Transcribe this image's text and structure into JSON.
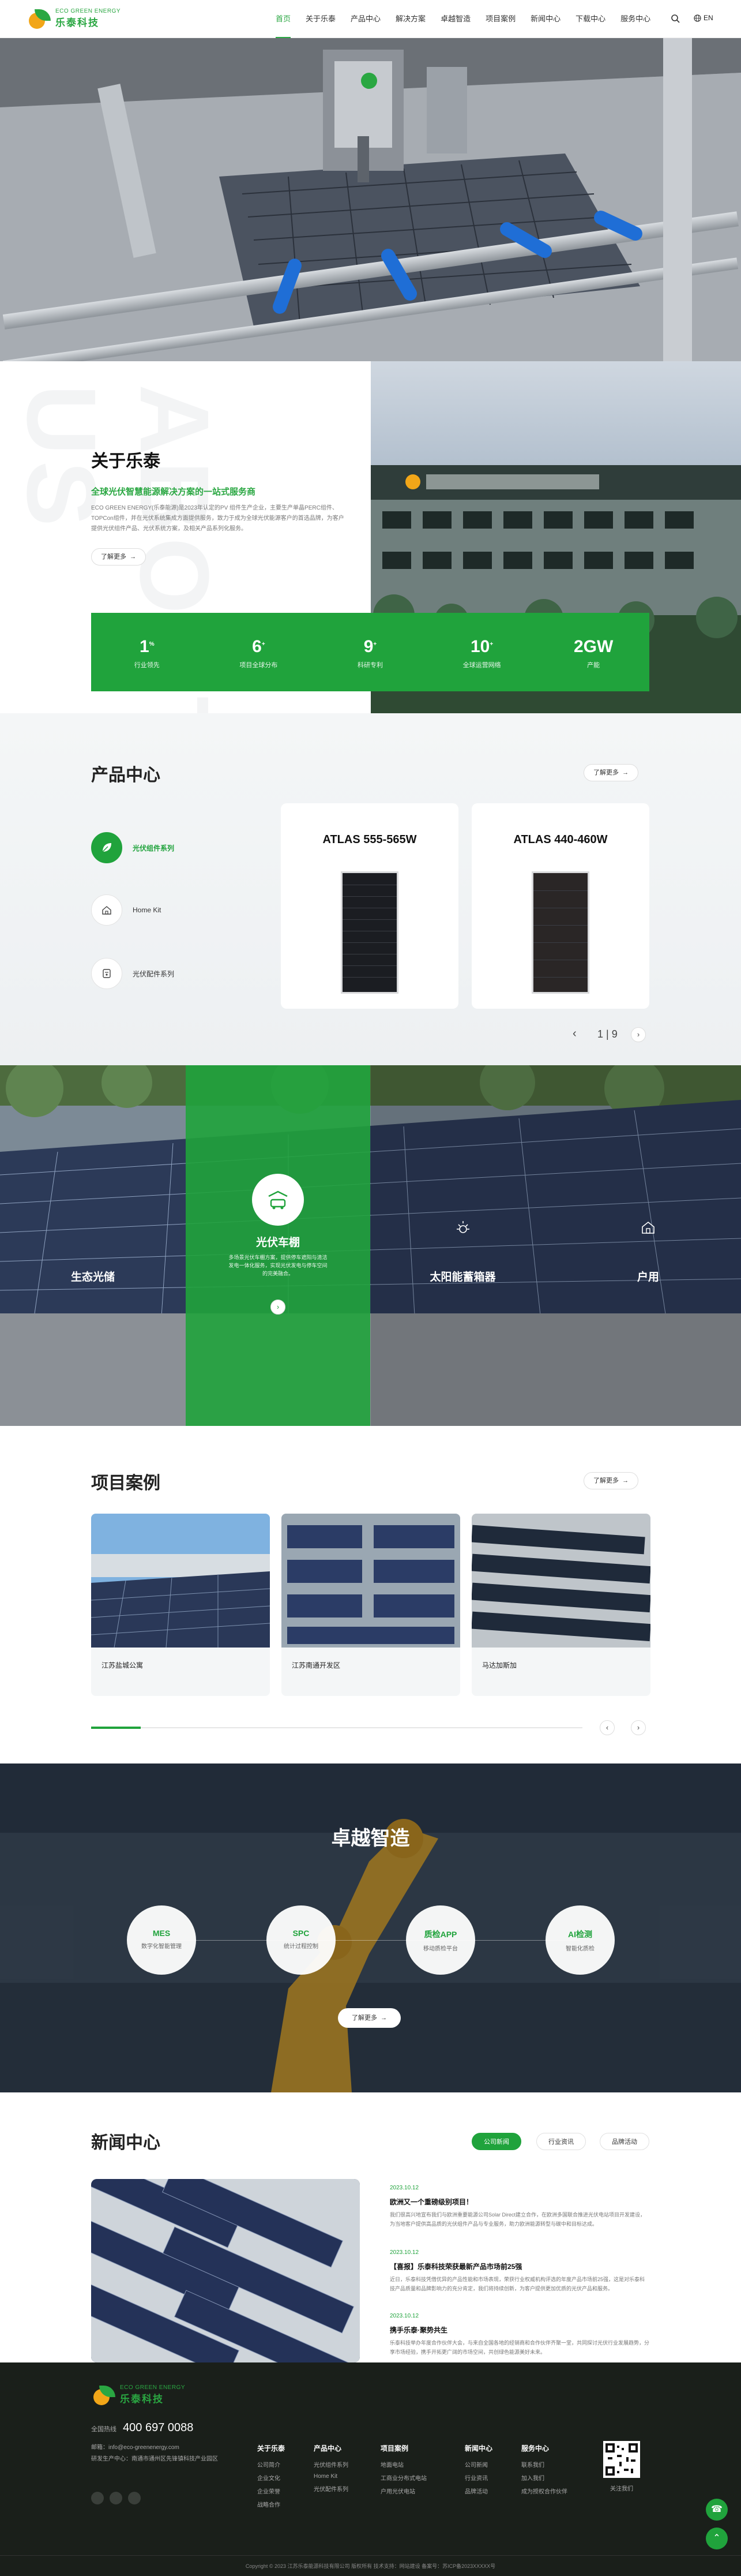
{
  "header": {
    "logo_en": "ECO GREEN ENERGY",
    "logo_cn": "乐泰科技",
    "nav": [
      "首页",
      "关于乐泰",
      "产品中心",
      "解决方案",
      "卓越智造",
      "项目案例",
      "新闻中心",
      "下载中心",
      "服务中心"
    ],
    "lang": "EN"
  },
  "about": {
    "bg_text": "ABOUT US",
    "title": "关于乐泰",
    "subtitle": "全球光伏智慧能源解决方案的一站式服务商",
    "desc": "ECO GREEN ENERGY(乐泰能源)是2023年认定的PV 组件生产企业，主要生产单晶PERC组件、TOPCon组件，并在光伏系统集成方面提供服务，致力于成为全球光伏能源客户的首选品牌，为客户提供光伏组件产品、光伏系统方案，及相关产品系列化服务。",
    "more": "了解更多",
    "stats": [
      {
        "num": "1",
        "sup": "%",
        "label": "行业领先"
      },
      {
        "num": "6",
        "sup": "+",
        "label": "项目全球分布"
      },
      {
        "num": "9",
        "sup": "+",
        "label": "科研专利"
      },
      {
        "num": "10",
        "sup": "+",
        "label": "全球运营网络"
      },
      {
        "num": "2GW",
        "sup": "",
        "label": "产能"
      }
    ]
  },
  "products": {
    "title": "产品中心",
    "more": "了解更多",
    "categories": [
      "光伏组件系列",
      "Home Kit",
      "光伏配件系列"
    ],
    "cards": [
      "ATLAS 555-565W",
      "ATLAS 440-460W"
    ],
    "pager_current": "1",
    "pager_total": "9"
  },
  "solutions": {
    "items": [
      "生态光储",
      "光伏车棚",
      "太阳能蓄箱器",
      "户用"
    ],
    "active_desc": "多场景光伏车棚方案，提供停车遮阳与清洁发电一体化服务，实现光伏发电与停车空间的完美融合。"
  },
  "cases": {
    "title": "项目案例",
    "more": "了解更多",
    "items": [
      "江苏盐城公寓",
      "江苏南通开发区",
      "马达加斯加"
    ]
  },
  "smart": {
    "title": "卓越智造",
    "items": [
      {
        "a": "MES",
        "b": "数字化智能管理"
      },
      {
        "a": "SPC",
        "b": "统计过程控制"
      },
      {
        "a": "质检APP",
        "b": "移动质检平台"
      },
      {
        "a": "AI检测",
        "b": "智能化质检"
      }
    ],
    "more": "了解更多"
  },
  "news": {
    "title": "新闻中心",
    "tabs": [
      "公司新闻",
      "行业资讯",
      "品牌活动"
    ],
    "items": [
      {
        "date": "2023.10.12",
        "title": "欧洲又一个重磅级别项目！",
        "text": "我们很高兴地宣布我们与欧洲重要能源公司Solar Direct建立合作，在欧洲多国联合推进光伏电站项目开发建设，为当地客户提供高品质的光伏组件产品与专业服务，助力欧洲能源转型与碳中和目标达成。"
      },
      {
        "date": "2023.10.12",
        "title": "【喜报】乐泰科技荣获最新产品市场前25强",
        "text": "近日，乐泰科技凭借优异的产品性能和市场表现，荣获行业权威机构评选的年度产品市场前25强，这是对乐泰科技产品质量和品牌影响力的充分肯定，我们将持续创新，为客户提供更加优质的光伏产品和服务。"
      },
      {
        "date": "2023.10.12",
        "title": "携手乐泰·聚势共生",
        "text": "乐泰科技举办年度合作伙伴大会，与来自全国各地的经销商和合作伙伴齐聚一堂，共同探讨光伏行业发展趋势，分享市场经验，携手开拓更广阔的市场空间，共创绿色能源美好未来。"
      }
    ]
  },
  "footer": {
    "hotline_label": "全国热线",
    "hotline": "400 697 0088",
    "email_label": "邮箱：",
    "email": "info@eco-greenenergy.com",
    "addr_label": "研发生产中心：",
    "addr": "南通市通州区先锋镇科技产业园区",
    "cols": [
      {
        "h": "关于乐泰",
        "items": [
          "公司简介",
          "企业文化",
          "企业荣誉",
          "战略合作"
        ]
      },
      {
        "h": "产品中心",
        "items": [
          "光伏组件系列",
          "Home Kit",
          "光伏配件系列"
        ]
      },
      {
        "h": "项目案例",
        "items": [
          "地面电站",
          "工商业分布式电站",
          "户用光伏电站"
        ]
      },
      {
        "h": "新闻中心",
        "items": [
          "公司新闻",
          "行业资讯",
          "品牌活动"
        ]
      },
      {
        "h": "服务中心",
        "items": [
          "联系我们",
          "加入我们",
          "成为授权合作伙伴"
        ]
      }
    ],
    "qr": "关注我们",
    "copyright": "Copyright © 2023 江苏乐泰能源科技有限公司 版权所有  技术支持：网站建设 备案号：苏ICP备2023XXXXX号"
  },
  "colors": {
    "brand": "#20a33c",
    "footer_bg": "#1a1f1a"
  }
}
